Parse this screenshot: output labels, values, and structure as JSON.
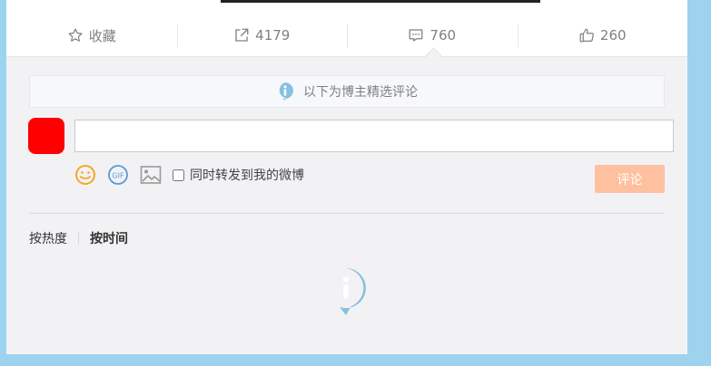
{
  "actions": {
    "favorite_label": "收藏",
    "repost_count": "4179",
    "comment_count": "760",
    "like_count": "260"
  },
  "notice": {
    "text": "以下为博主精选评论"
  },
  "composer": {
    "input_value": "",
    "forward_label": "同时转发到我的微博",
    "submit_label": "评论",
    "gif_label": "GIF"
  },
  "sort": {
    "hot_label": "按热度",
    "time_label": "按时间"
  },
  "colors": {
    "background": "#9dd3ef",
    "accent_button": "#ffc09f",
    "info_icon": "#88c0e0",
    "emoji": "#f5a623",
    "avatar": "#ff0000"
  }
}
